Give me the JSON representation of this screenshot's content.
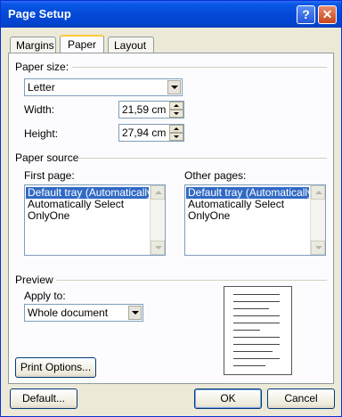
{
  "window": {
    "title": "Page Setup"
  },
  "tabs": [
    {
      "label": "Margins"
    },
    {
      "label": "Paper"
    },
    {
      "label": "Layout"
    }
  ],
  "paper_size": {
    "section_label": "Paper size:",
    "selected": "Letter",
    "width_label": "Width:",
    "width_value": "21,59 cm",
    "height_label": "Height:",
    "height_value": "27,94 cm"
  },
  "paper_source": {
    "section_label": "Paper source",
    "first_page_label": "First page:",
    "other_pages_label": "Other pages:",
    "first_items": [
      "Default tray (Automatically S",
      "Automatically Select",
      "OnlyOne"
    ],
    "other_items": [
      "Default tray (Automatically S",
      "Automatically Select",
      "OnlyOne"
    ],
    "selected_index": 0
  },
  "preview": {
    "section_label": "Preview",
    "apply_to_label": "Apply to:",
    "apply_to_value": "Whole document"
  },
  "buttons": {
    "print_options": "Print Options...",
    "default": "Default...",
    "ok": "OK",
    "cancel": "Cancel"
  },
  "colors": {
    "titlebar": "#0449d6",
    "selection": "#316ac5",
    "dialog_bg": "#ece9d8"
  }
}
